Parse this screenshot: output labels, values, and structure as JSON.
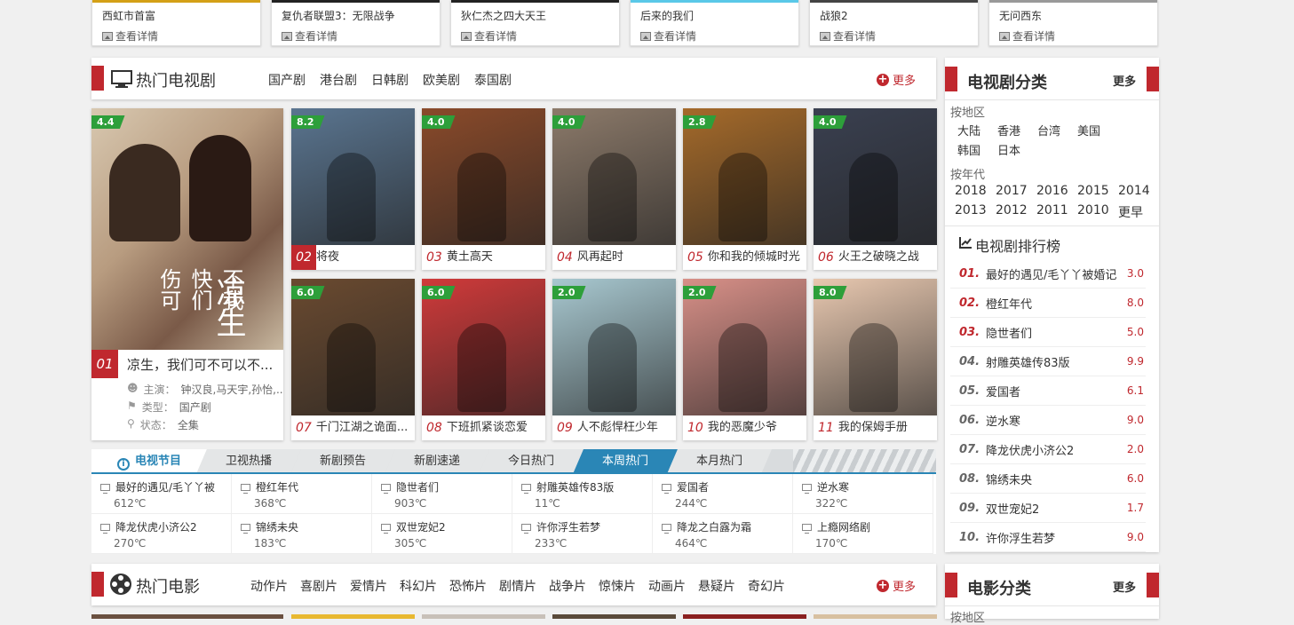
{
  "top_cards": [
    {
      "title": "西虹市首富",
      "link": "查看详情",
      "bar": "#d4a017"
    },
    {
      "title": "复仇者联盟3：无限战争",
      "link": "查看详情",
      "bar": "#222"
    },
    {
      "title": "狄仁杰之四大天王",
      "link": "查看详情",
      "bar": "#222"
    },
    {
      "title": "后来的我们",
      "link": "查看详情",
      "bar": "#5ac8e8"
    },
    {
      "title": "战狼2",
      "link": "查看详情",
      "bar": "#444"
    },
    {
      "title": "无问西东",
      "link": "查看详情",
      "bar": "#999"
    }
  ],
  "tv_section": {
    "title": "热门电视剧",
    "nav": [
      "国产剧",
      "港台剧",
      "日韩剧",
      "欧美剧",
      "泰国剧"
    ],
    "more": "更多"
  },
  "featured": {
    "rating": "4.4",
    "num": "01",
    "title": "凉生，我们可不可以不...",
    "actors_label": "主演：",
    "actors": "钟汉良,马天宇,孙怡,...",
    "type_label": "类型：",
    "type": "国产剧",
    "status_label": "状态：",
    "status": "全集"
  },
  "shows": [
    {
      "rating": "8.2",
      "num": "02",
      "title": "将夜",
      "color": "#5a7590"
    },
    {
      "rating": "4.0",
      "num": "03",
      "title": "黄土高天",
      "color": "#8a4a2a"
    },
    {
      "rating": "4.0",
      "num": "04",
      "title": "风再起时",
      "color": "#8c7a6a"
    },
    {
      "rating": "2.8",
      "num": "05",
      "title": "你和我的倾城时光",
      "color": "#a56a2a"
    },
    {
      "rating": "4.0",
      "num": "06",
      "title": "火王之破晓之战",
      "color": "#3a4050"
    },
    {
      "rating": "6.0",
      "num": "07",
      "title": "千门江湖之诡面...",
      "color": "#6a4a30"
    },
    {
      "rating": "6.0",
      "num": "08",
      "title": "下班抓紧谈恋爱",
      "color": "#d03a3a"
    },
    {
      "rating": "2.0",
      "num": "09",
      "title": "人不彪悍枉少年",
      "color": "#a8c8d0"
    },
    {
      "rating": "2.0",
      "num": "10",
      "title": "我的恶魔少爷",
      "color": "#d89088"
    },
    {
      "rating": "8.0",
      "num": "11",
      "title": "我的保姆手册",
      "color": "#e8c8b0"
    }
  ],
  "tabs": [
    "电视节目",
    "卫视热播",
    "新剧预告",
    "新剧速递",
    "今日热门",
    "本周热门",
    "本月热门"
  ],
  "hot_items": [
    {
      "title": "最好的遇见/毛丫丫被",
      "value": "612℃"
    },
    {
      "title": "橙红年代",
      "value": "368℃"
    },
    {
      "title": "隐世者们",
      "value": "903℃"
    },
    {
      "title": "射雕英雄传83版",
      "value": "11℃"
    },
    {
      "title": "爱国者",
      "value": "244℃"
    },
    {
      "title": "逆水寒",
      "value": "322℃"
    },
    {
      "title": "降龙伏虎小济公2",
      "value": "270℃"
    },
    {
      "title": "锦绣未央",
      "value": "183℃"
    },
    {
      "title": "双世宠妃2",
      "value": "305℃"
    },
    {
      "title": "许你浮生若梦",
      "value": "233℃"
    },
    {
      "title": "降龙之白露为霜",
      "value": "464℃"
    },
    {
      "title": "上瘾网络剧",
      "value": "170℃"
    }
  ],
  "side_tv": {
    "title": "电视剧分类",
    "more": "更多",
    "region_label": "按地区",
    "regions": [
      "大陆",
      "香港",
      "台湾",
      "美国",
      "韩国",
      "日本"
    ],
    "year_label": "按年代",
    "years": [
      "2018",
      "2017",
      "2016",
      "2015",
      "2014",
      "2013",
      "2012",
      "2011",
      "2010",
      "更早"
    ],
    "rank_title": "电视剧排行榜",
    "ranks": [
      {
        "num": "01.",
        "title": "最好的遇见/毛丫丫被婚记",
        "score": "3.0"
      },
      {
        "num": "02.",
        "title": "橙红年代",
        "score": "8.0"
      },
      {
        "num": "03.",
        "title": "隐世者们",
        "score": "5.0"
      },
      {
        "num": "04.",
        "title": "射雕英雄传83版",
        "score": "9.9"
      },
      {
        "num": "05.",
        "title": "爱国者",
        "score": "6.1"
      },
      {
        "num": "06.",
        "title": "逆水寒",
        "score": "9.0"
      },
      {
        "num": "07.",
        "title": "降龙伏虎小济公2",
        "score": "2.0"
      },
      {
        "num": "08.",
        "title": "锦绣未央",
        "score": "6.0"
      },
      {
        "num": "09.",
        "title": "双世宠妃2",
        "score": "1.7"
      },
      {
        "num": "10.",
        "title": "许你浮生若梦",
        "score": "9.0"
      }
    ]
  },
  "movie_section": {
    "title": "热门电影",
    "nav": [
      "动作片",
      "喜剧片",
      "爱情片",
      "科幻片",
      "恐怖片",
      "剧情片",
      "战争片",
      "惊悚片",
      "动画片",
      "悬疑片",
      "奇幻片"
    ],
    "more": "更多"
  },
  "side_movie": {
    "title": "电影分类",
    "more": "更多",
    "region_label": "按地区"
  },
  "accent": "#c0282e",
  "tab_active": "#2a86b6",
  "rating_green": "#2d9f3a"
}
